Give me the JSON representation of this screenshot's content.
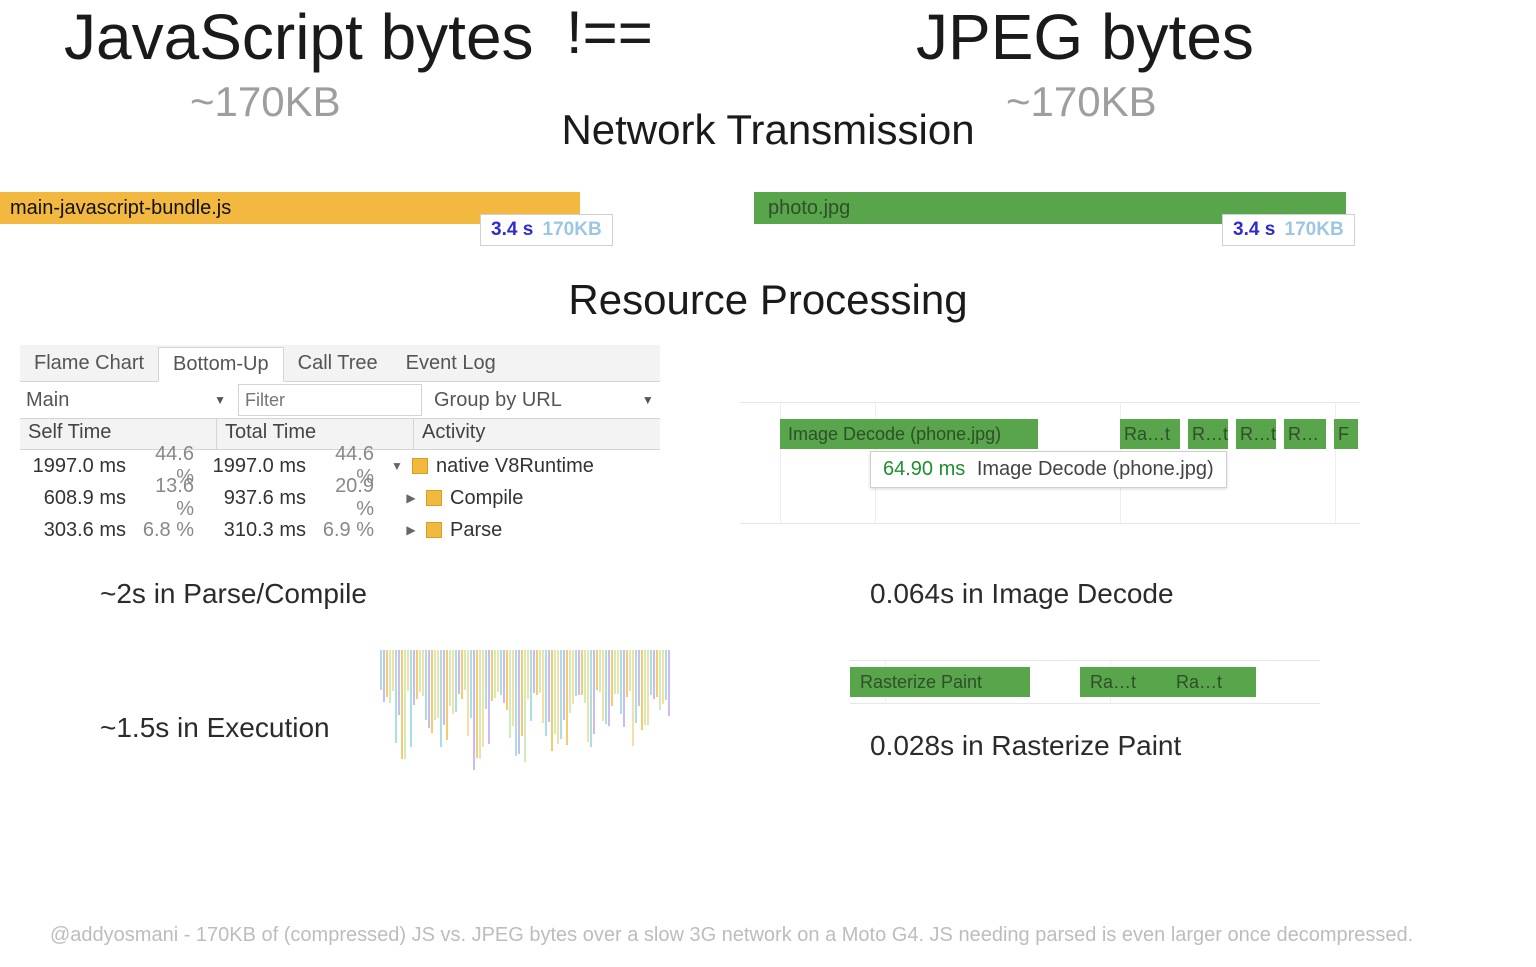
{
  "heading": {
    "js": "JavaScript bytes",
    "neq": "!==",
    "jpeg": "JPEG bytes",
    "js_size": "~170KB",
    "jpeg_size": "~170KB"
  },
  "sections": {
    "network": "Network Transmission",
    "processing": "Resource Processing"
  },
  "network": {
    "js_file": "main-javascript-bundle.js",
    "img_file": "photo.jpg",
    "js_time": "3.4 s",
    "js_size": "170KB",
    "img_time": "3.4 s",
    "img_size": "170KB"
  },
  "devtools": {
    "tabs": [
      "Flame Chart",
      "Bottom-Up",
      "Call Tree",
      "Event Log"
    ],
    "active_tab": "Bottom-Up",
    "thread": "Main",
    "filter_placeholder": "Filter",
    "group": "Group by URL",
    "cols": {
      "c1": "Self Time",
      "c2": "Total Time",
      "c3": "Activity"
    },
    "rows": [
      {
        "self_ms": "1997.0 ms",
        "self_pct": "44.6 %",
        "self_w": 86,
        "tot_ms": "1997.0 ms",
        "tot_pct": "44.6 %",
        "tot_w": 86,
        "act": "native V8Runtime",
        "exp": "▼"
      },
      {
        "self_ms": "608.9 ms",
        "self_pct": "13.6 %",
        "self_w": 30,
        "tot_ms": "937.6 ms",
        "tot_pct": "20.9 %",
        "tot_w": 42,
        "act": "Compile",
        "exp": "▶"
      },
      {
        "self_ms": "303.6 ms",
        "self_pct": "6.8 %",
        "self_w": 16,
        "tot_ms": "310.3 ms",
        "tot_pct": "6.9 %",
        "tot_w": 16,
        "act": "Parse",
        "exp": "▶"
      }
    ]
  },
  "image_decode": {
    "main_label": "Image Decode (phone.jpg)",
    "small": [
      "Ra…t",
      "R…t",
      "R…t",
      "R…",
      "F"
    ],
    "tip_ms": "64.90 ms",
    "tip_lbl": "Image Decode (phone.jpg)"
  },
  "rasterize": {
    "bars": [
      "Rasterize Paint",
      "Ra…t",
      "Ra…t"
    ]
  },
  "summary": {
    "parse": "~2s in Parse/Compile",
    "exec": "~1.5s in Execution",
    "decode": "0.064s in Image Decode",
    "raster": "0.028s in Rasterize Paint"
  },
  "footer": "@addyosmani - 170KB of (compressed) JS vs. JPEG bytes over a slow 3G network on a Moto G4. JS needing parsed is even larger once decompressed."
}
